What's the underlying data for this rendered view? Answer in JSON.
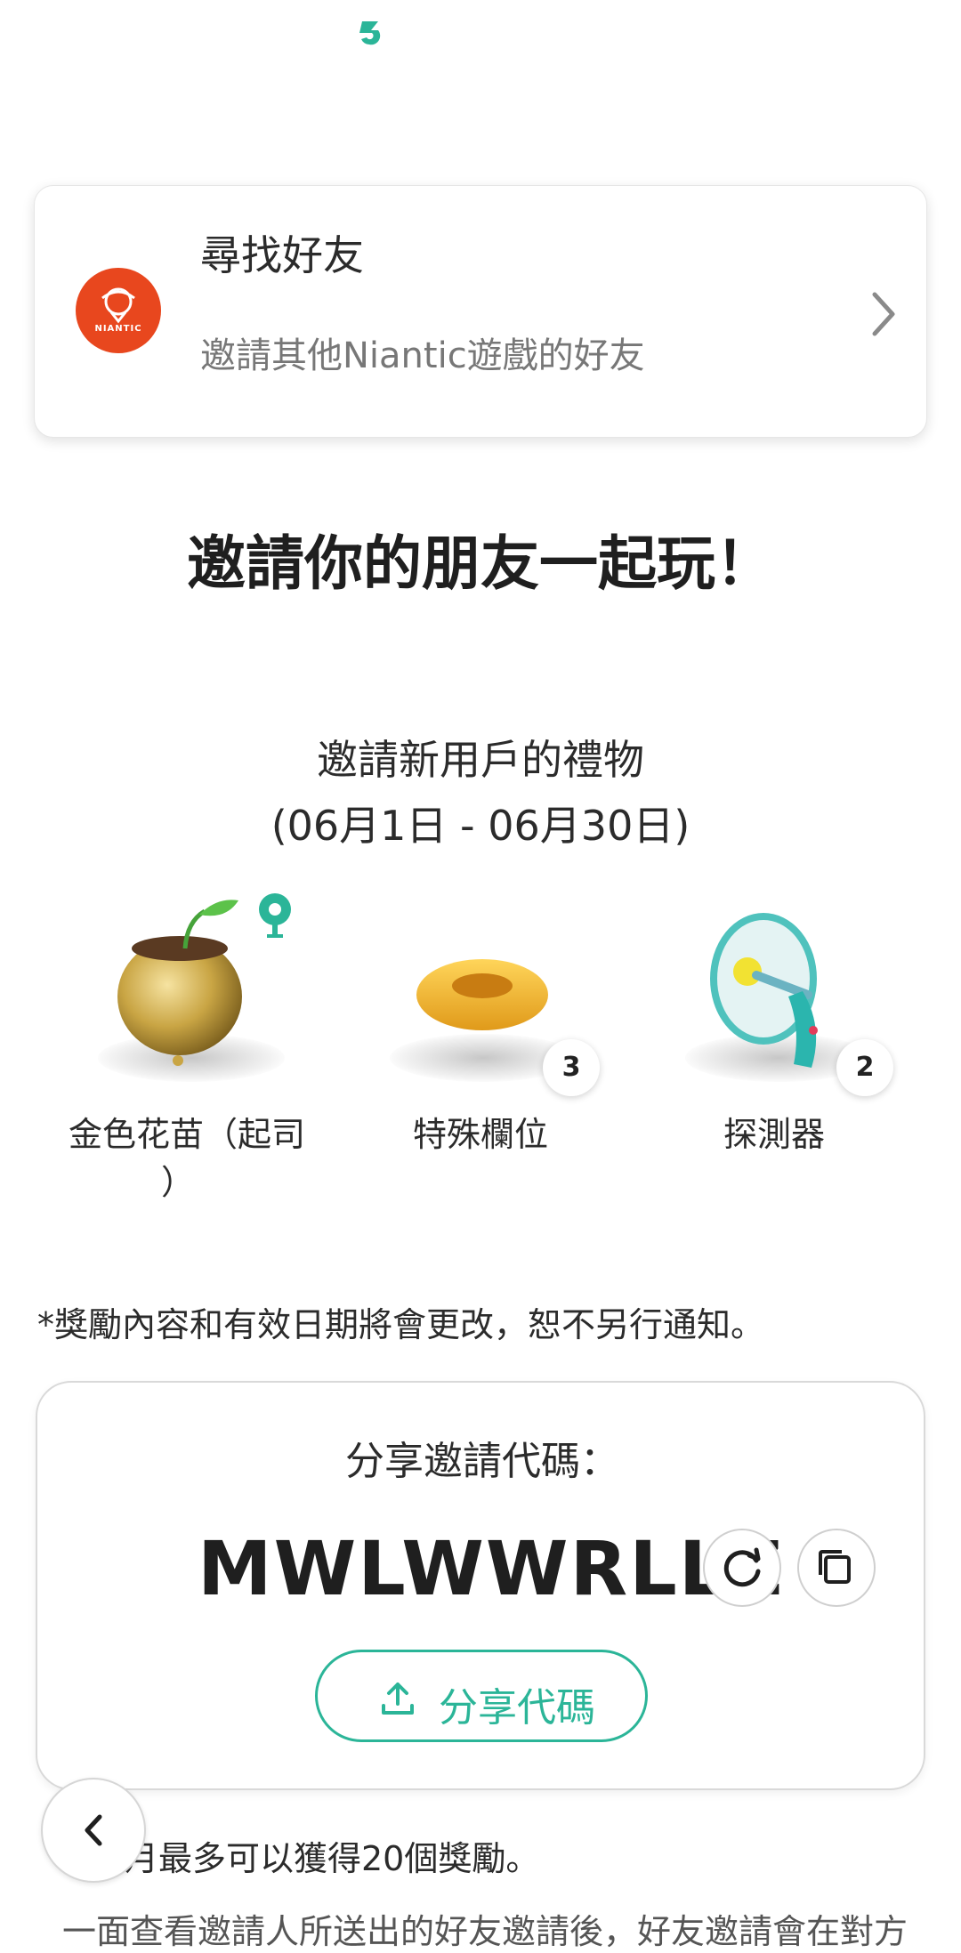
{
  "top_logo": {
    "icon": "app-logo-icon",
    "color": "#2bb598"
  },
  "find_friends": {
    "title": "尋找好友",
    "subtitle": "邀請其他Niantic遊戲的好友",
    "logo_text": "NIANTIC",
    "logo_color": "#e8471e"
  },
  "headline": "邀請你的朋友一起玩！",
  "gifts": {
    "title": "邀請新用戶的禮物",
    "date_range": "(06月1日 - 06月30日)",
    "items": [
      {
        "label": "金色花苗（起司",
        "label_line2": "）",
        "count": ""
      },
      {
        "label": "特殊欄位",
        "count": "3"
      },
      {
        "label": "探測器",
        "count": "2"
      }
    ]
  },
  "notice": "*獎勵內容和有效日期將會更改，恕不另行通知。",
  "invite": {
    "label": "分享邀請代碼：",
    "code": "MWLWWRLLZ",
    "share_label": "分享代碼",
    "accent_color": "#2bb598"
  },
  "footer": {
    "monthly": "月最多可以獲得20個獎勵。",
    "more": "一面查看邀請人所送出的好友邀請後，好友邀請會在對方"
  }
}
